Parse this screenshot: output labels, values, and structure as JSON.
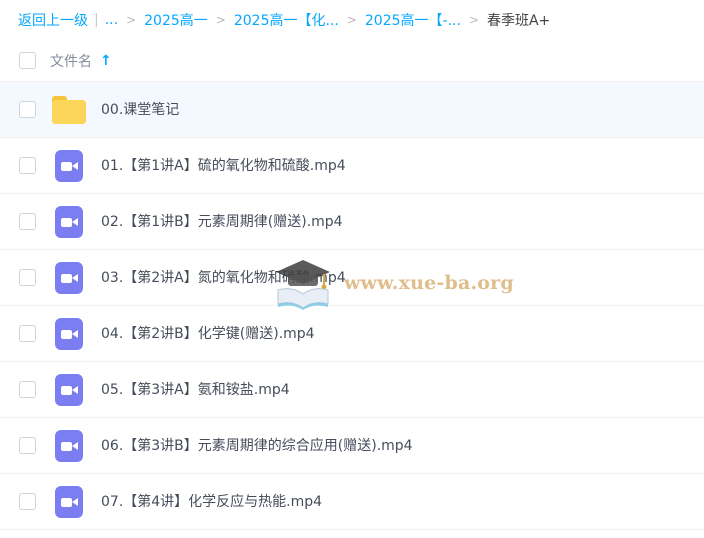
{
  "breadcrumb": {
    "back_label": "返回上一级",
    "ellipsis": "...",
    "separator": ">",
    "crumbs": [
      "2025高一",
      "2025高一【化...",
      "2025高一【-..."
    ],
    "current": "春季班A+"
  },
  "table": {
    "column_name": "文件名",
    "sort_icon": "arrow-up-icon",
    "sort_glyph": "🡑"
  },
  "files": [
    {
      "name": "00.课堂笔记",
      "icon": "folder-icon",
      "type": "folder"
    },
    {
      "name": "01.【第1讲A】硫的氧化物和硫酸.mp4",
      "icon": "video-file-icon",
      "type": "video"
    },
    {
      "name": "02.【第1讲B】元素周期律(赠送).mp4",
      "icon": "video-file-icon",
      "type": "video"
    },
    {
      "name": "03.【第2讲A】氮的氧化物和硝酸.mp4",
      "icon": "video-file-icon",
      "type": "video"
    },
    {
      "name": "04.【第2讲B】化学键(赠送).mp4",
      "icon": "video-file-icon",
      "type": "video"
    },
    {
      "name": "05.【第3讲A】氨和铵盐.mp4",
      "icon": "video-file-icon",
      "type": "video"
    },
    {
      "name": "06.【第3讲B】元素周期律的综合应用(赠送).mp4",
      "icon": "video-file-icon",
      "type": "video"
    },
    {
      "name": "07.【第4讲】化学反应与热能.mp4",
      "icon": "video-file-icon",
      "type": "video"
    }
  ],
  "watermark": {
    "text": "www.xue-ba.org"
  },
  "colors": {
    "accent": "#06a7ff",
    "folder": "#fcd65b",
    "video": "#7b7ef0",
    "hover_row": "#f3f9fe"
  }
}
